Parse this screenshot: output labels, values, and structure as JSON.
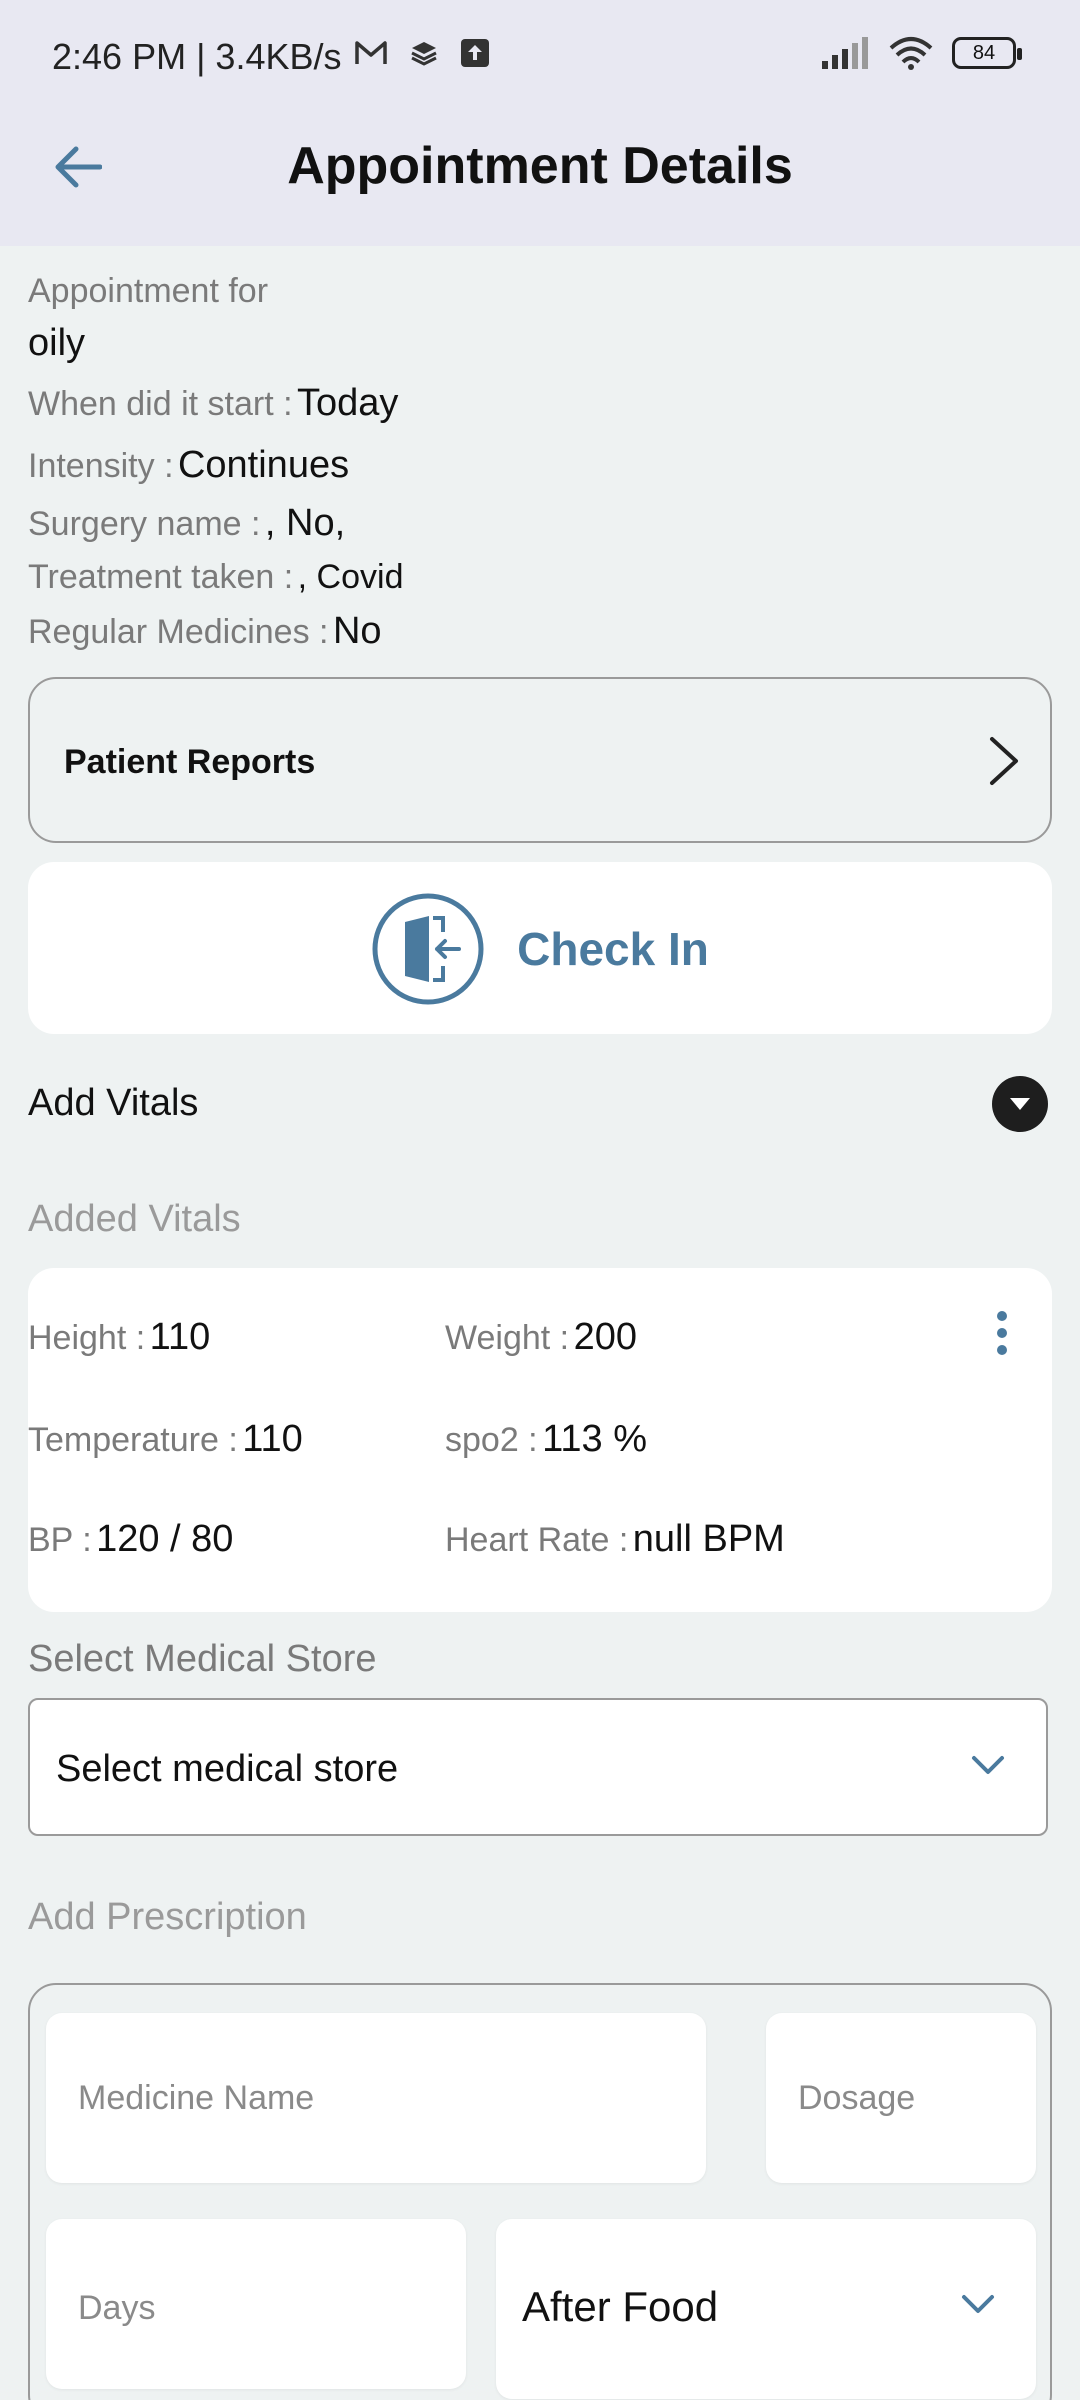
{
  "status_bar": {
    "time": "2:46 PM | 3.4KB/s",
    "battery": "84"
  },
  "header": {
    "title": "Appointment Details"
  },
  "details": {
    "appointment_for_label": "Appointment for",
    "appointment_for_value": "oily",
    "start_label": "When did it start :",
    "start_value": "Today",
    "intensity_label": "Intensity :",
    "intensity_value": "Continues",
    "surgery_label": "Surgery name :",
    "surgery_value": ",  No,",
    "treatment_label": "Treatment taken :",
    "treatment_value": ",  Covid",
    "medicines_label": "Regular Medicines :",
    "medicines_value": "No"
  },
  "patient_reports": {
    "label": "Patient Reports"
  },
  "check_in": {
    "label": "Check In"
  },
  "add_vitals": {
    "label": "Add Vitals"
  },
  "added_vitals": {
    "heading": "Added Vitals",
    "height_label": "Height :",
    "height_value": "110",
    "weight_label": "Weight :",
    "weight_value": "200",
    "temperature_label": "Temperature :",
    "temperature_value": "110",
    "spo2_label": "spo2 :",
    "spo2_value": "113 %",
    "bp_label": "BP :",
    "bp_value": "120 / 80",
    "heart_rate_label": "Heart Rate :",
    "heart_rate_value": "null BPM"
  },
  "medical_store": {
    "heading": "Select Medical Store",
    "selected": "Select medical store"
  },
  "prescription": {
    "heading": "Add Prescription",
    "medicine_placeholder": "Medicine Name",
    "dosage_placeholder": "Dosage",
    "days_placeholder": "Days",
    "timing_value": "After Food"
  },
  "colors": {
    "accent": "#4a7a9e",
    "appbar_bg": "#e8e8f2",
    "page_bg": "#eef2f2"
  }
}
